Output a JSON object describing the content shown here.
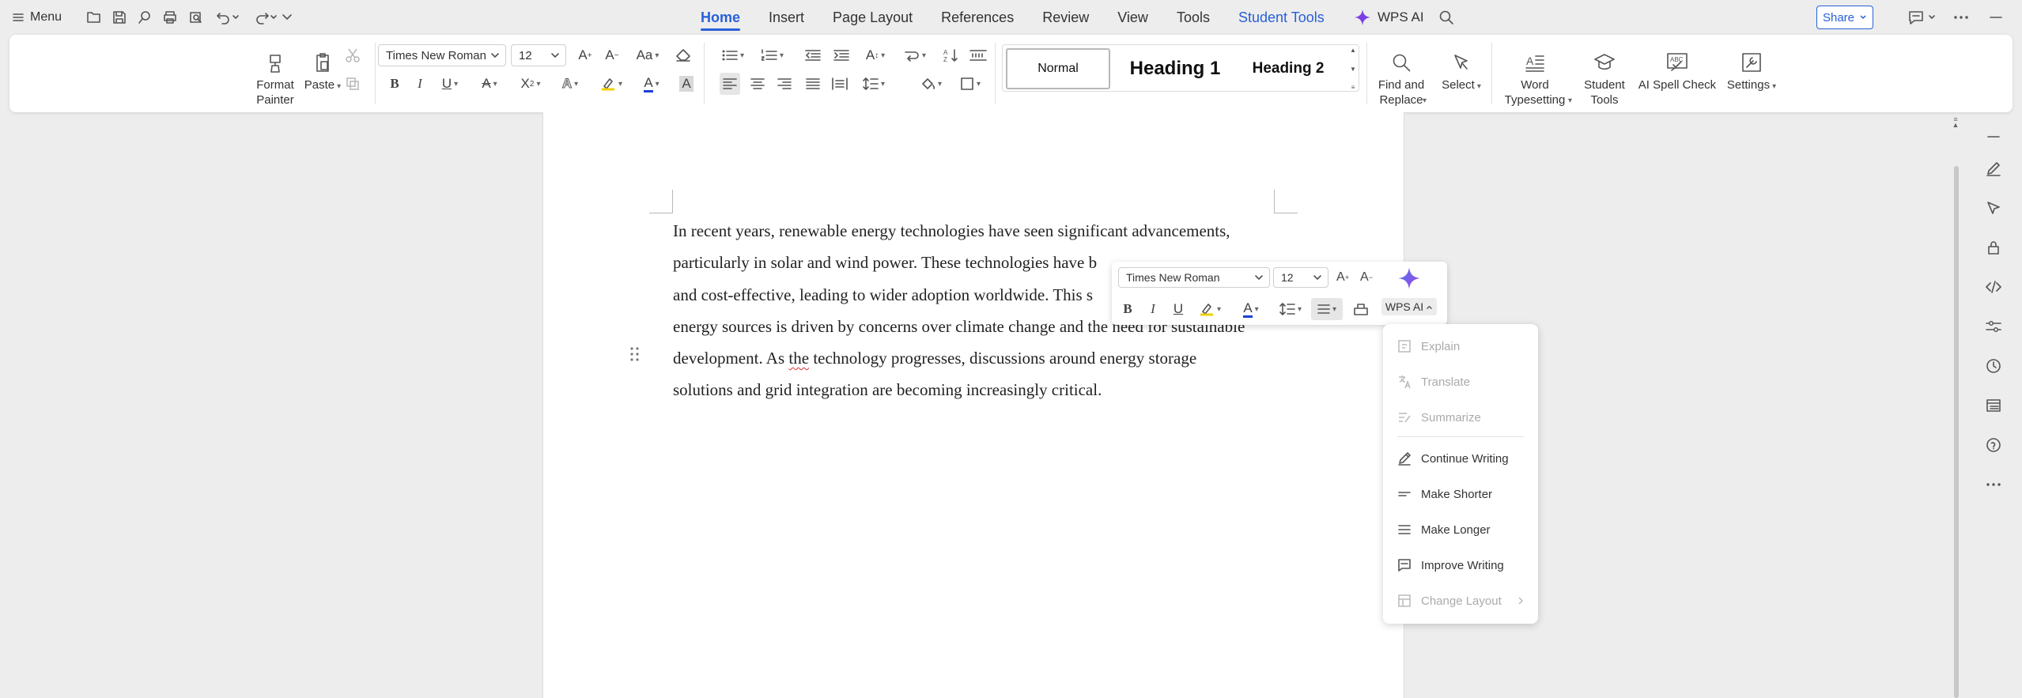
{
  "topbar": {
    "menu_label": "Menu",
    "tabs": [
      {
        "label": "Home",
        "active": true
      },
      {
        "label": "Insert"
      },
      {
        "label": "Page Layout"
      },
      {
        "label": "References"
      },
      {
        "label": "Review"
      },
      {
        "label": "View"
      },
      {
        "label": "Tools"
      },
      {
        "label": "Student Tools"
      }
    ],
    "wps_ai_label": "WPS AI",
    "share_label": "Share"
  },
  "ribbon": {
    "format_painter": "Format\nPainter",
    "paste": "Paste",
    "font_name": "Times New Roman",
    "font_size": "12",
    "styles": {
      "normal": "Normal",
      "h1": "Heading 1",
      "h2": "Heading 2"
    },
    "find_replace": "Find and\nReplace",
    "select": "Select",
    "word_typesetting": "Word\nTypesetting",
    "student_tools": "Student\nTools",
    "ai_spell_check": "AI Spell Check",
    "settings": "Settings",
    "spell_icon_text": "ABC"
  },
  "document": {
    "lines": [
      "In recent years, renewable energy technologies have seen significant advancements,",
      "particularly in solar and wind power. These technologies have b",
      "and cost-effective, leading to wider adoption worldwide. This s",
      "energy sources is driven by concerns over climate change and the need for sustainable",
      "development. As ",
      "solutions and grid integration are becoming increasingly critical."
    ],
    "line5_marked": "the",
    "line5_rest": " technology progresses, discussions around energy storage"
  },
  "mini_toolbar": {
    "font_name": "Times New Roman",
    "font_size": "12",
    "wps_ai_label": "WPS AI"
  },
  "ai_menu": {
    "items": [
      {
        "label": "Explain",
        "enabled": false
      },
      {
        "label": "Translate",
        "enabled": false
      },
      {
        "label": "Summarize",
        "enabled": false
      },
      {
        "label": "Continue Writing",
        "enabled": true
      },
      {
        "label": "Make Shorter",
        "enabled": true
      },
      {
        "label": "Make Longer",
        "enabled": true
      },
      {
        "label": "Improve Writing",
        "enabled": true
      },
      {
        "label": "Change Layout",
        "enabled": false
      }
    ]
  },
  "colors": {
    "accent": "#2860d8",
    "ai_purple": "#7b3fe4",
    "font_color_bar": "#1a3fd6",
    "squiggle": "#e03030"
  }
}
